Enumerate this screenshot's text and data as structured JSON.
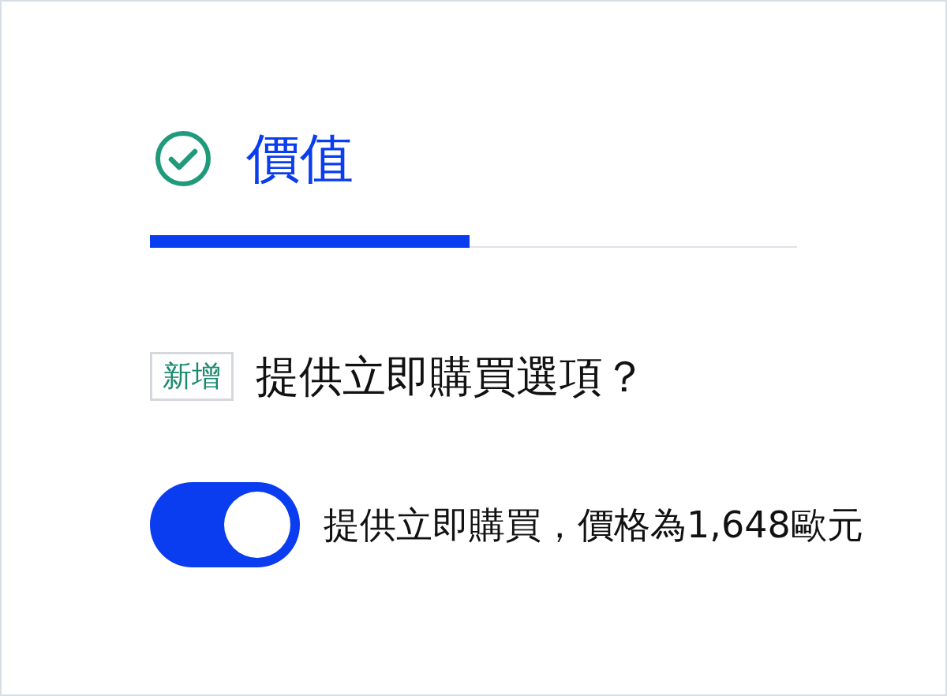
{
  "header": {
    "title": "價值",
    "complete": true
  },
  "progress": {
    "level": 0.494
  },
  "question": {
    "badge": "新增",
    "text": "提供立即購買選項？"
  },
  "toggle": {
    "on": true,
    "label": "提供立即購買，價格為1,648歐元"
  }
}
